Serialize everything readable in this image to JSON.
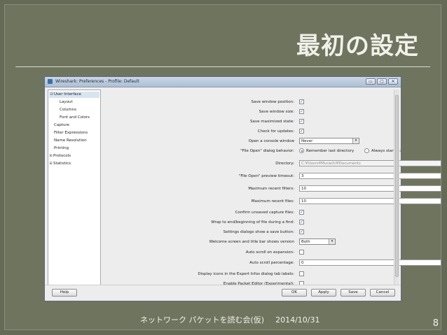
{
  "slide": {
    "title": "最初の設定",
    "footer_text": "ネットワーク パケットを読む会(仮)",
    "footer_date": "2014/10/31",
    "page_number": "8"
  },
  "window": {
    "title": "Wireshark: Preferences - Profile: Default",
    "controls": [
      "▭",
      "▢",
      "✕"
    ]
  },
  "sidebar": {
    "items": [
      {
        "label": "User Interface",
        "toggle": "⊟",
        "level": 0,
        "selected": true
      },
      {
        "label": "Layout",
        "toggle": "",
        "level": 1
      },
      {
        "label": "Columns",
        "toggle": "",
        "level": 1
      },
      {
        "label": "Font and Colors",
        "toggle": "",
        "level": 1
      },
      {
        "label": "Capture",
        "toggle": "",
        "level": 0
      },
      {
        "label": "Filter Expressions",
        "toggle": "",
        "level": 0
      },
      {
        "label": "Name Resolution",
        "toggle": "",
        "level": 0
      },
      {
        "label": "Printing",
        "toggle": "",
        "level": 0
      },
      {
        "label": "Protocols",
        "toggle": "⊞",
        "level": 0
      },
      {
        "label": "Statistics",
        "toggle": "⊞",
        "level": 0
      }
    ]
  },
  "prefs": {
    "save_window_position": {
      "label": "Save window position:",
      "checked": "✓"
    },
    "save_window_size": {
      "label": "Save window size:",
      "checked": "✓"
    },
    "save_maximized_state": {
      "label": "Save maximized state:",
      "checked": "✓"
    },
    "check_for_updates": {
      "label": "Check for updates:",
      "checked": "✓"
    },
    "open_console_window": {
      "label": "Open a console window",
      "value": "Never",
      "arrow": "▾"
    },
    "file_open_behavior": {
      "label": "\"File Open\" dialog behavior:",
      "option1": "Remember last directory",
      "option2": "Always start in:"
    },
    "directory": {
      "label": "Directory:",
      "value": "C:¥Users¥Murachi¥Documents"
    },
    "preview_timeout": {
      "label": "\"File Open\" preview timeout:",
      "value": "3"
    },
    "max_recent_filters": {
      "label": "Maximum recent filters:",
      "value": "10"
    },
    "max_recent_files": {
      "label": "Maximum recent files:",
      "value": "10"
    },
    "confirm_unsaved": {
      "label": "Confirm unsaved capture files:",
      "checked": "✓"
    },
    "wrap_find": {
      "label": "Wrap to end/beginning of file during a find:",
      "checked": "✓"
    },
    "settings_save_button": {
      "label": "Settings dialogs show a save button:",
      "checked": "✓"
    },
    "welcome_version": {
      "label": "Welcome screen and title bar shows version",
      "value": "Both",
      "arrow": "▾"
    },
    "auto_scroll_expansion": {
      "label": "Auto scroll on expansion:",
      "checked": ""
    },
    "auto_scroll_percentage": {
      "label": "Auto scroll percentage:",
      "value": "0"
    },
    "expert_infos_icons": {
      "label": "Display icons in the Expert Infos dialog tab labels:",
      "checked": ""
    },
    "packet_editor": {
      "label": "Enable Packet Editor (Experimental):",
      "checked": ""
    }
  },
  "buttons": {
    "help": "Help",
    "ok": "OK",
    "apply": "Apply",
    "save": "Save",
    "cancel": "Cancel"
  }
}
